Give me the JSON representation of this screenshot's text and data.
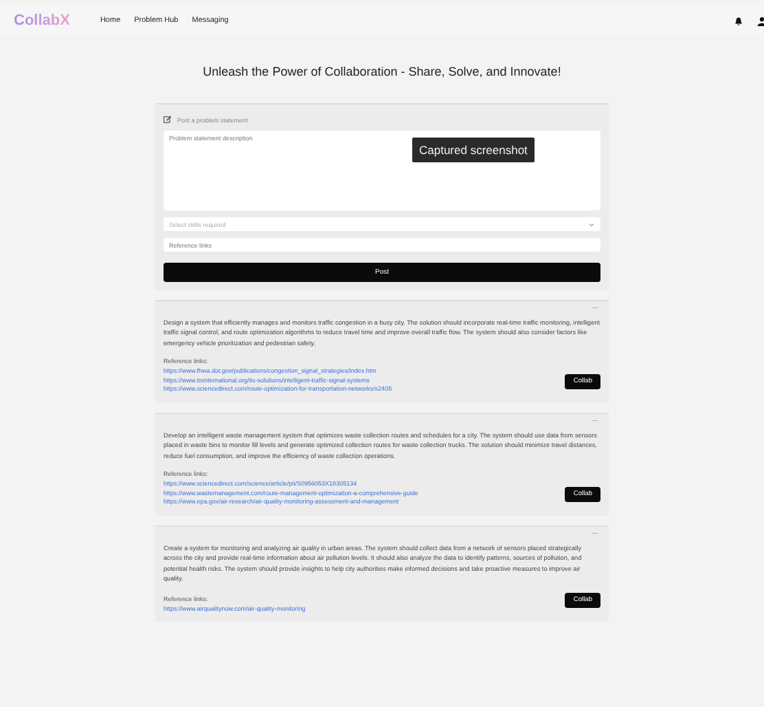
{
  "nav": {
    "logo": "CollabX",
    "links": [
      "Home",
      "Problem Hub",
      "Messaging"
    ]
  },
  "headline": "Unleash the Power of Collaboration - Share, Solve, and Innovate!",
  "form": {
    "label": "Post a problem statement",
    "description": {
      "placeholder": "Problem statement description"
    },
    "skills": {
      "placeholder": "Select skills required"
    },
    "links": {
      "placeholder": "Reference links"
    },
    "submit": "Post"
  },
  "tooltip": "Captured screenshot",
  "problems": [
    {
      "menu": "...",
      "description": "Design a system that efficiently manages and monitors traffic congestion in a busy city. The solution should incorporate real-time traffic monitoring, intelligent traffic signal control, and route optimization algorithms to reduce travel time and improve overall traffic flow. The system should also consider factors like emergency vehicle prioritization and pedestrian safety.",
      "links_label": "Reference links:",
      "links": [
        "https://www.fhwa.dot.gov/publications/congestion_signal_strategies/index.htm",
        "https://www.itsinternational.org/its-solutions/intelligent-traffic-signal-systems",
        "https://www.sciencedirect.com/route-optimization-for-transportation-networks/s2405"
      ],
      "action": "Collab"
    },
    {
      "menu": "...",
      "description": "Develop an intelligent waste management system that optimizes waste collection routes and schedules for a city. The system should use data from sensors placed in waste bins to monitor fill levels and generate optimized collection routes for waste collection trucks. The solution should minimize travel distances, reduce fuel consumption, and improve the efficiency of waste collection operations.",
      "links_label": "Reference links:",
      "links": [
        "https://www.sciencedirect.com/science/article/pii/S0956053X18305134",
        "https://www.wastemanagement.com/route-management-optimization-a-comprehensive-guide",
        "https://www.epa.gov/air-research/air-quality-monitoring-assessment-and-management"
      ],
      "action": "Collab"
    },
    {
      "menu": "...",
      "description": "Create a system for monitoring and analyzing air quality in urban areas. The system should collect data from a network of sensors placed strategically across the city and provide real-time information about air pollution levels. It should also analyze the data to identify patterns, sources of pollution, and potential health risks. The system should provide insights to help city authorities make informed decisions and take proactive measures to improve air quality.",
      "links_label": "Reference links:",
      "links": [
        "https://www.airqualitynow.com/air-quality-monitoring"
      ],
      "action": "Collab"
    }
  ]
}
